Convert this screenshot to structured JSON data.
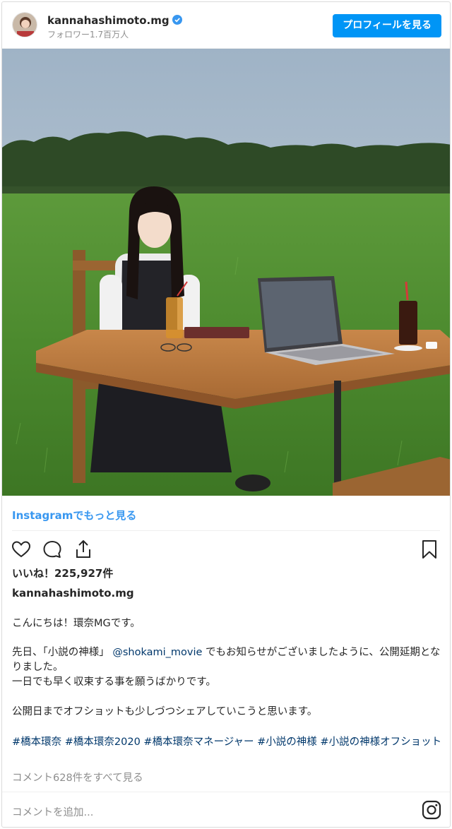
{
  "header": {
    "username": "kannahashimoto.mg",
    "followers": "フォロワー1.7百万人",
    "profile_button": "プロフィールを見る"
  },
  "more_link": "Instagramでもっと見る",
  "likes": "いいね！225,927件",
  "poster": "kannahashimoto.mg",
  "caption": {
    "line1": "こんにちは！環奈MGです。",
    "line2a": "先日、「小説の神様」 ",
    "mention": "@shokami_movie",
    "line2b": " でもお知らせがございましたように、公開延期となりました。",
    "line3": "一日でも早く収束する事を願うばかりです。",
    "line4": "公開日までオフショットも少しづつシェアしていこうと思います。",
    "hashtags": "#橋本環奈 #橋本環奈2020 #橋本環奈マネージャー #小説の神様 #小説の神様オフショット"
  },
  "view_comments": "コメント628件をすべて見る",
  "comment_placeholder": "コメントを追加...",
  "colors": {
    "accent": "#0095f6",
    "link": "#3897f0",
    "hashtag": "#00376b"
  }
}
